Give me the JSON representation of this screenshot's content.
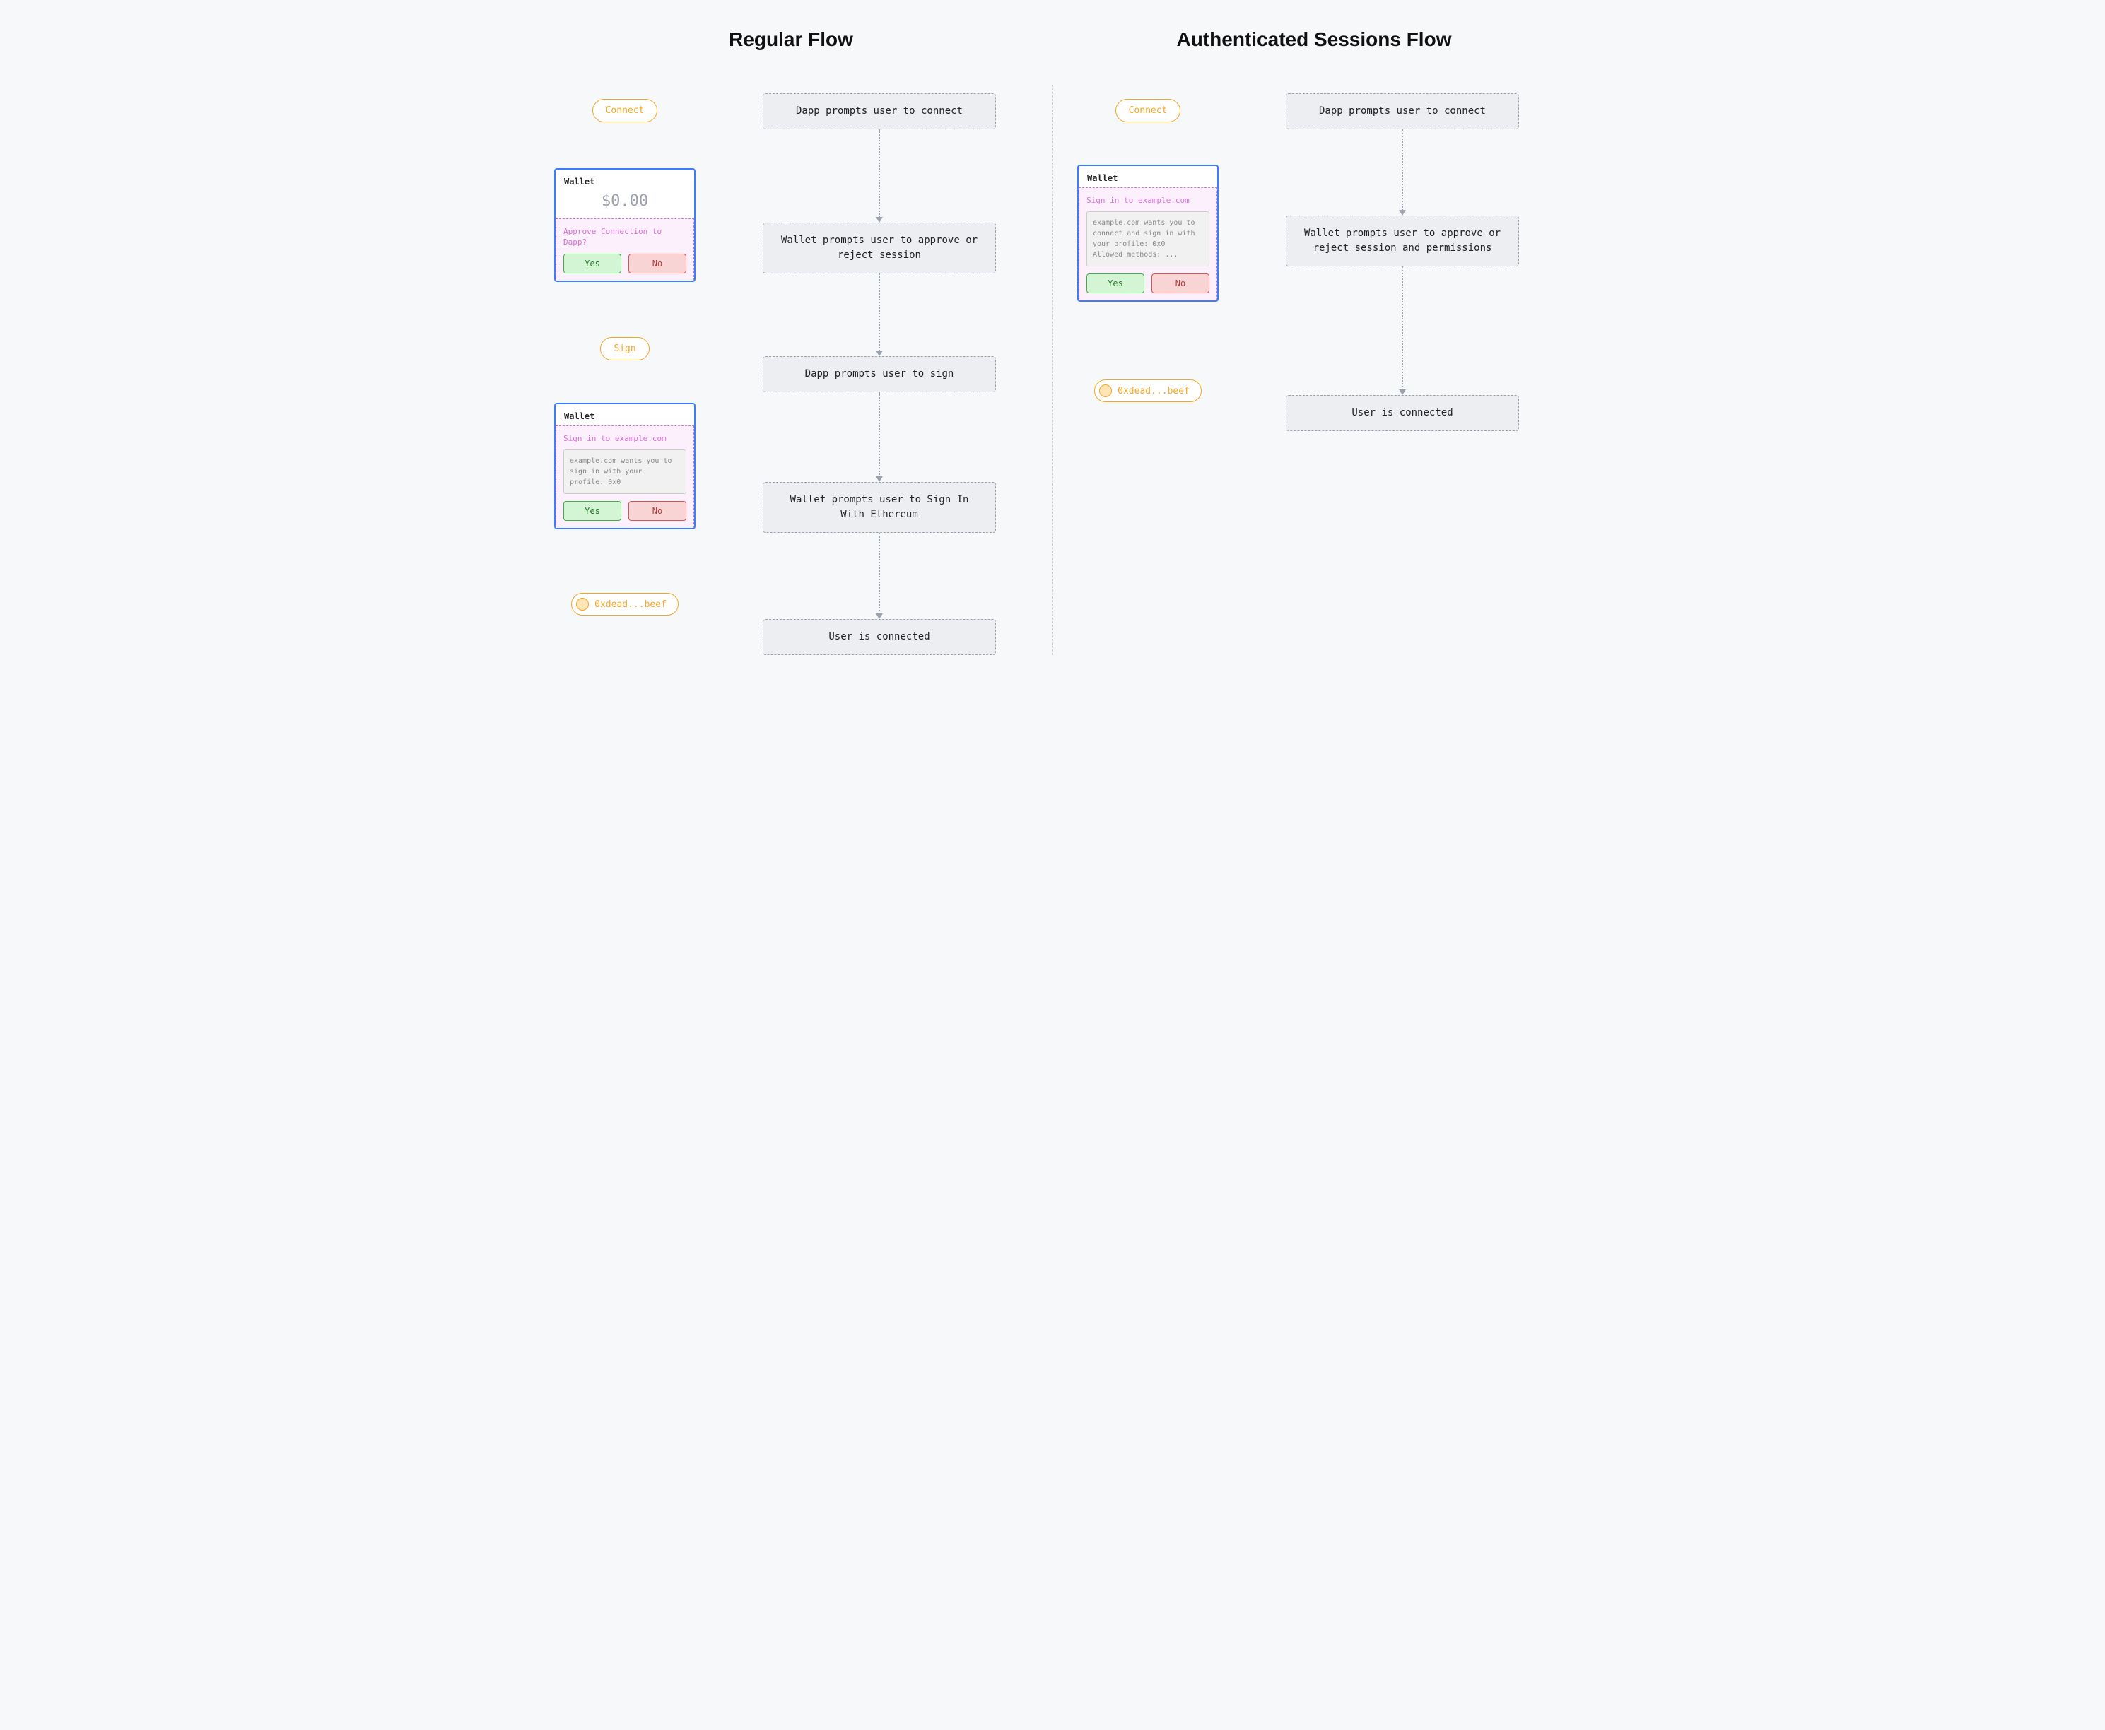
{
  "left": {
    "title": "Regular Flow",
    "ui": {
      "connect_label": "Connect",
      "wallet1": {
        "header": "Wallet",
        "balance": "$0.00",
        "modal_title": "Approve Connection to Dapp?",
        "yes": "Yes",
        "no": "No"
      },
      "sign_label": "Sign",
      "wallet2": {
        "header": "Wallet",
        "modal_title": "Sign in to example.com",
        "modal_body": "example.com wants you to sign in with your profile: 0x0",
        "yes": "Yes",
        "no": "No"
      },
      "connected_address": "0xdead...beef"
    },
    "steps": [
      "Dapp prompts user to connect",
      "Wallet prompts user to approve or reject session",
      "Dapp prompts user to sign",
      "Wallet prompts user to Sign In With Ethereum",
      "User is connected"
    ]
  },
  "right": {
    "title": "Authenticated Sessions Flow",
    "ui": {
      "connect_label": "Connect",
      "wallet1": {
        "header": "Wallet",
        "modal_title": "Sign in to example.com",
        "modal_body": "example.com wants you to connect and sign in with your profile: 0x0\nAllowed methods: ...",
        "yes": "Yes",
        "no": "No"
      },
      "connected_address": "0xdead...beef"
    },
    "steps": [
      "Dapp prompts user to connect",
      "Wallet prompts user to approve or reject session and permissions",
      "User is connected"
    ]
  }
}
